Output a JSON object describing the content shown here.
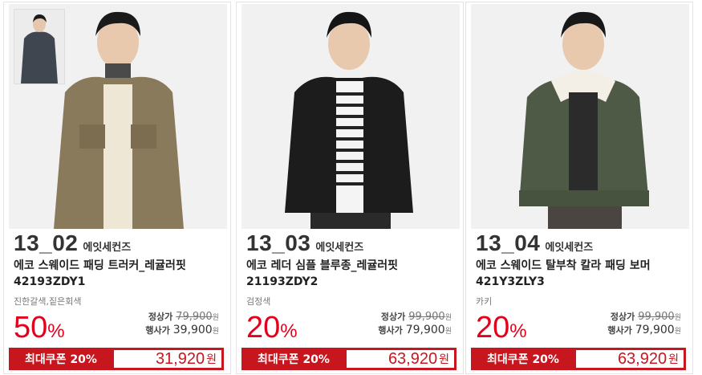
{
  "products": [
    {
      "code": "13_02",
      "brand": "에잇세컨즈",
      "name_line1": "에코 스웨이드 패딩 트러커_레귤러핏",
      "name_line2": "42193ZDY1",
      "color": "진한갈색,짙은회색",
      "discount_num": "50",
      "discount_pct": "%",
      "regular_label": "정상가",
      "regular_price": "79,900",
      "sale_label": "행사가",
      "sale_price": "39,900",
      "won_small": "원",
      "coupon_label": "최대쿠폰 20%",
      "coupon_price": "31,920",
      "coupon_won": "원",
      "jacket_color": "#8a7a5c"
    },
    {
      "code": "13_03",
      "brand": "에잇세컨즈",
      "name_line1": "에코 레더 심플 블루종_레귤러핏",
      "name_line2": "21193ZDY2",
      "color": "검정색",
      "discount_num": "20",
      "discount_pct": "%",
      "regular_label": "정상가",
      "regular_price": "99,900",
      "sale_label": "행사가",
      "sale_price": "79,900",
      "won_small": "원",
      "coupon_label": "최대쿠폰 20%",
      "coupon_price": "63,920",
      "coupon_won": "원",
      "jacket_color": "#1c1c1c"
    },
    {
      "code": "13_04",
      "brand": "에잇세컨즈",
      "name_line1": "에코 스웨이드 탈부착 칼라 패딩 보머",
      "name_line2": "421Y3ZLY3",
      "color": "카키",
      "discount_num": "20",
      "discount_pct": "%",
      "regular_label": "정상가",
      "regular_price": "99,900",
      "sale_label": "행사가",
      "sale_price": "79,900",
      "won_small": "원",
      "coupon_label": "최대쿠폰 20%",
      "coupon_price": "63,920",
      "coupon_won": "원",
      "jacket_color": "#4e5a45"
    }
  ],
  "colors": {
    "discount_red": "#e3001b",
    "coupon_red": "#c8161e"
  }
}
